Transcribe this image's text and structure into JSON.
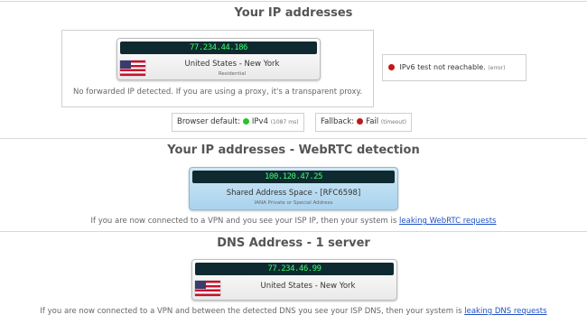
{
  "colors": {
    "ok": "#2cc12c",
    "error": "#c01818",
    "lcd_text": "#3cff6a",
    "link": "#1f4fc7"
  },
  "ip_section": {
    "title": "Your IP addresses",
    "ip": "77.234.44.186",
    "location": "United States - New York",
    "type": "Residential",
    "flag": "us-flag-icon",
    "forwarded_note": "No forwarded IP detected. If you are using a proxy, it's a transparent proxy.",
    "ipv6_label": "IPv6 test not reachable.",
    "ipv6_status": "(error)",
    "browser_default_label": "Browser default:",
    "browser_default_value": "IPv4",
    "browser_default_time": "(1087 ms)",
    "fallback_label": "Fallback:",
    "fallback_value": "Fail",
    "fallback_status": "(timeout)"
  },
  "webrtc_section": {
    "title": "Your IP addresses - WebRTC detection",
    "ip": "100.120.47.25",
    "description": "Shared Address Space - [RFC6598]",
    "sub": "IANA Private or Special Address",
    "note_text": "If you are now connected to a VPN and you see your ISP IP, then your system is",
    "note_link": "leaking WebRTC requests"
  },
  "dns_section": {
    "title": "DNS Address - 1 server",
    "ip": "77.234.46.99",
    "location": "United States - New York",
    "flag": "us-flag-icon",
    "note_text": "If you are now connected to a VPN and between the detected DNS you see your ISP DNS, then your system is",
    "note_link": "leaking DNS requests"
  }
}
